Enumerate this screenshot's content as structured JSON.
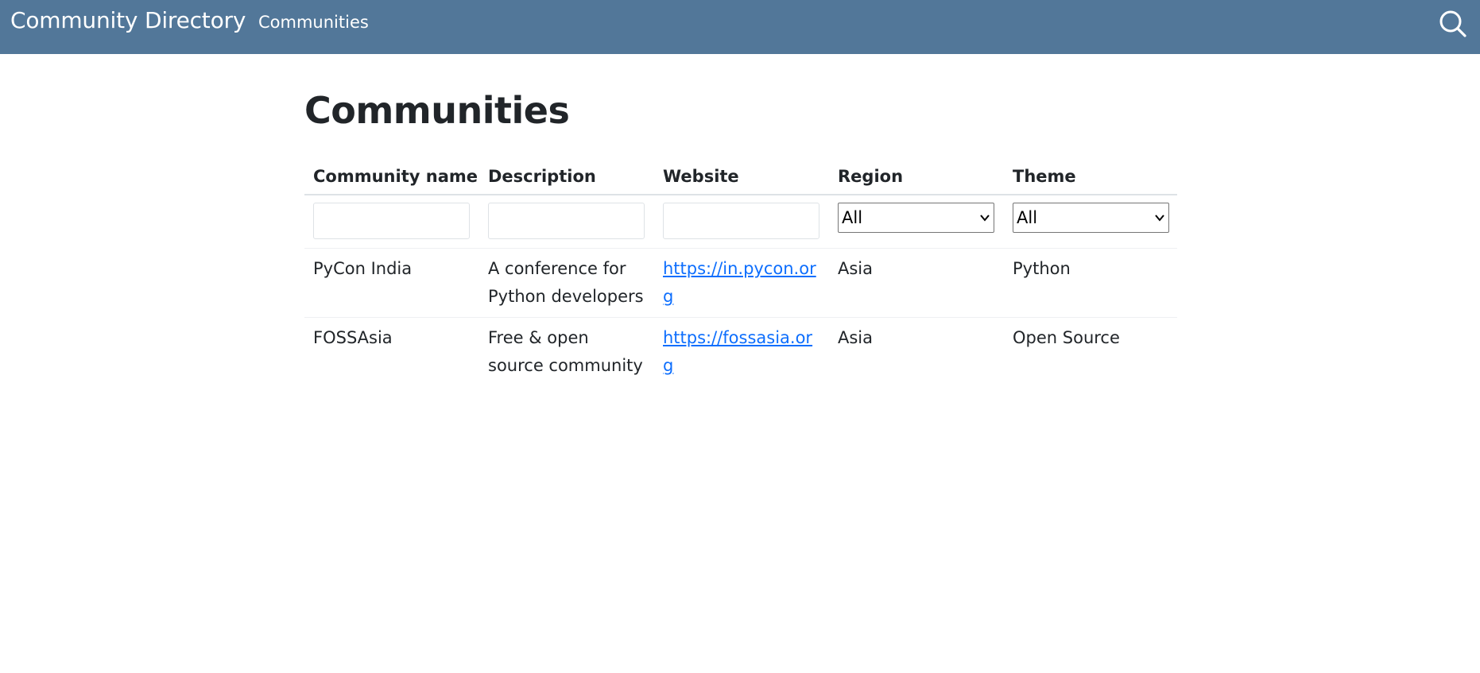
{
  "navbar": {
    "brand": "Community Directory",
    "link": "Communities",
    "search_icon": "search-icon",
    "background": "#527799"
  },
  "page": {
    "title": "Communities"
  },
  "table": {
    "headers": [
      "Community name",
      "Description",
      "Website",
      "Region",
      "Theme"
    ],
    "filters": {
      "name": "",
      "description": "",
      "website": "",
      "region": "All",
      "theme": "All"
    },
    "rows": [
      {
        "name": "PyCon India",
        "description": "A conference for Python developers",
        "website": "https://in.pycon.org",
        "region": "Asia",
        "theme": "Python"
      },
      {
        "name": "FOSSAsia",
        "description": "Free & open source community",
        "website": "https://fossasia.org",
        "region": "Asia",
        "theme": "Open Source"
      }
    ]
  },
  "colors": {
    "link": "#0d6efd",
    "text": "#212529"
  }
}
